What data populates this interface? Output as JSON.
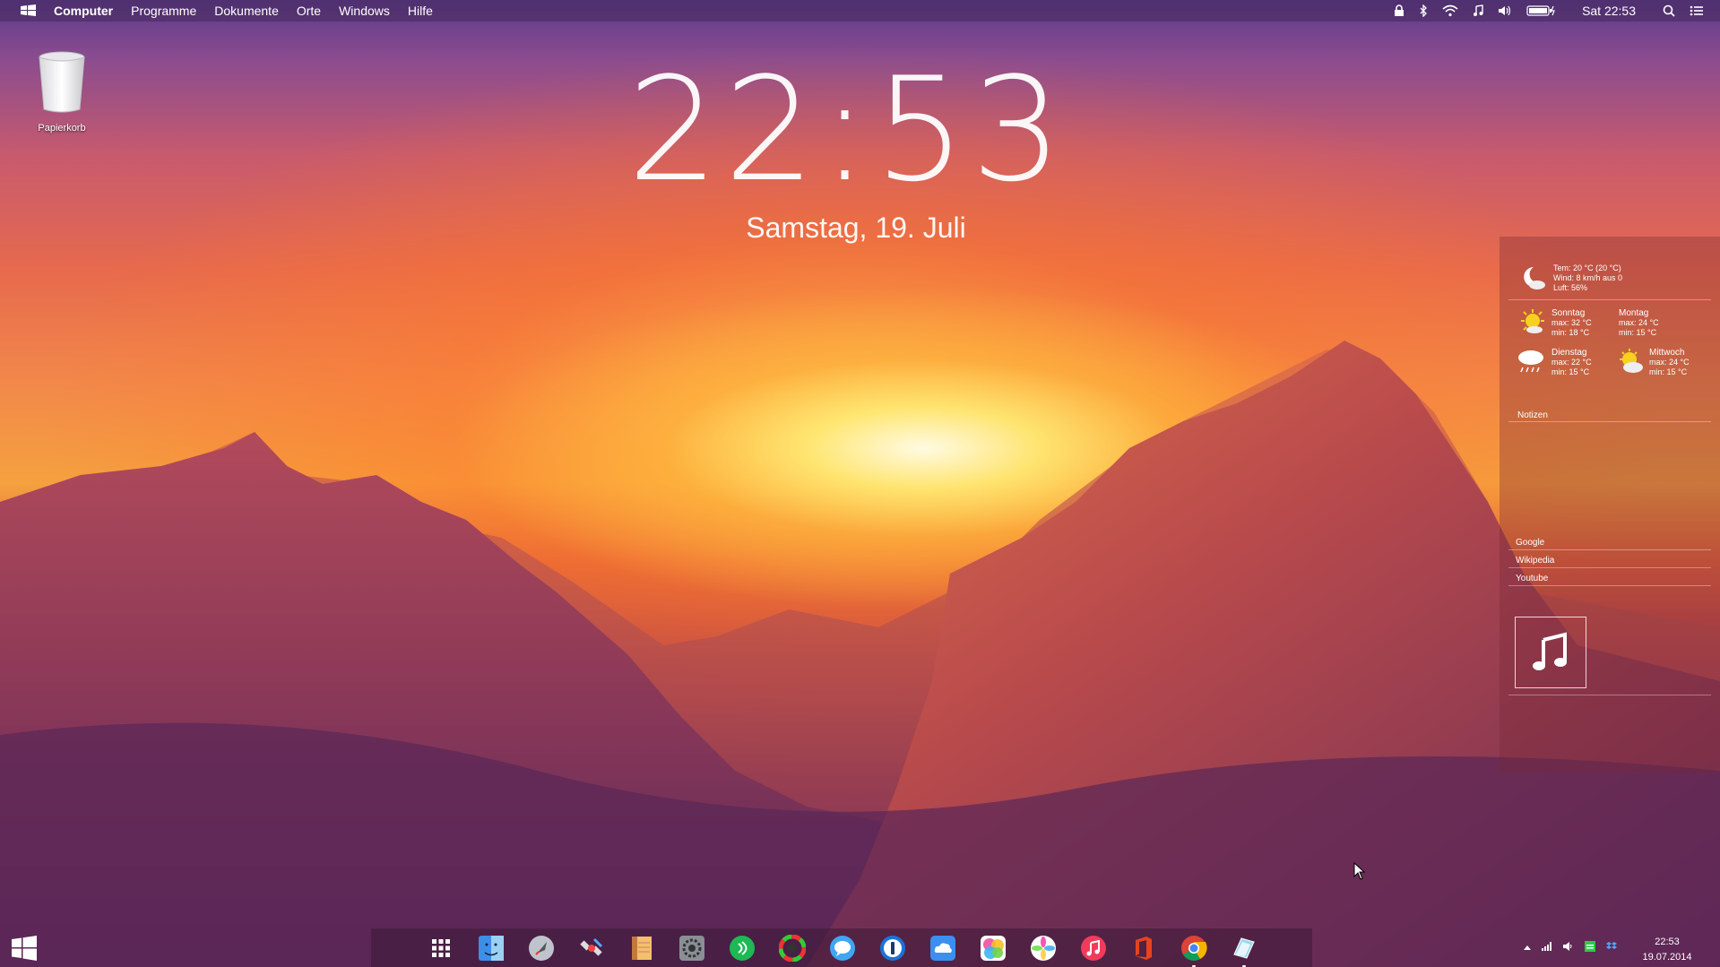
{
  "menubar": {
    "items": [
      "Computer",
      "Programme",
      "Dokumente",
      "Orte",
      "Windows",
      "Hilfe"
    ],
    "clock": "Sat 22:53"
  },
  "desktop": {
    "trash_label": "Papierkorb"
  },
  "clock_widget": {
    "time": "22:53",
    "date": "Samstag, 19. Juli"
  },
  "weather": {
    "current": {
      "temp": "Tem: 20 °C (20 °C)",
      "wind": "Wind: 8 km/h aus 0",
      "humidity": "Luft: 56%"
    },
    "forecast": [
      {
        "day": "Sonntag",
        "max": "max: 32 °C",
        "min": "min: 18 °C",
        "icon": "sunny-icon"
      },
      {
        "day": "Montag",
        "max": "max: 24 °C",
        "min": "min: 15 °C",
        "icon": "none"
      },
      {
        "day": "Dienstag",
        "max": "max: 22 °C",
        "min": "min: 15 °C",
        "icon": "rain-icon"
      },
      {
        "day": "Mittwoch",
        "max": "max: 24 °C",
        "min": "min: 15 °C",
        "icon": "partly-sunny-icon"
      }
    ]
  },
  "notes": {
    "title": "Notizen"
  },
  "links": [
    "Google",
    "Wikipedia",
    "Youtube"
  ],
  "dock_icons": [
    "apps-grid-icon",
    "finder-icon",
    "launchpad-rocket-icon",
    "satellite-icon",
    "notes-icon",
    "system-preferences-icon",
    "spotify-icon",
    "color-wheel-icon",
    "messages-icon",
    "onepassword-icon",
    "icloud-icon",
    "game-center-icon",
    "photos-icon",
    "itunes-icon",
    "office-icon",
    "chrome-icon",
    "preview-icon"
  ],
  "tray": {
    "time": "22:53",
    "date": "19.07.2014"
  },
  "colors": {
    "panel_bg": "rgba(120,40,55,0.35)",
    "text": "#ffffff"
  }
}
